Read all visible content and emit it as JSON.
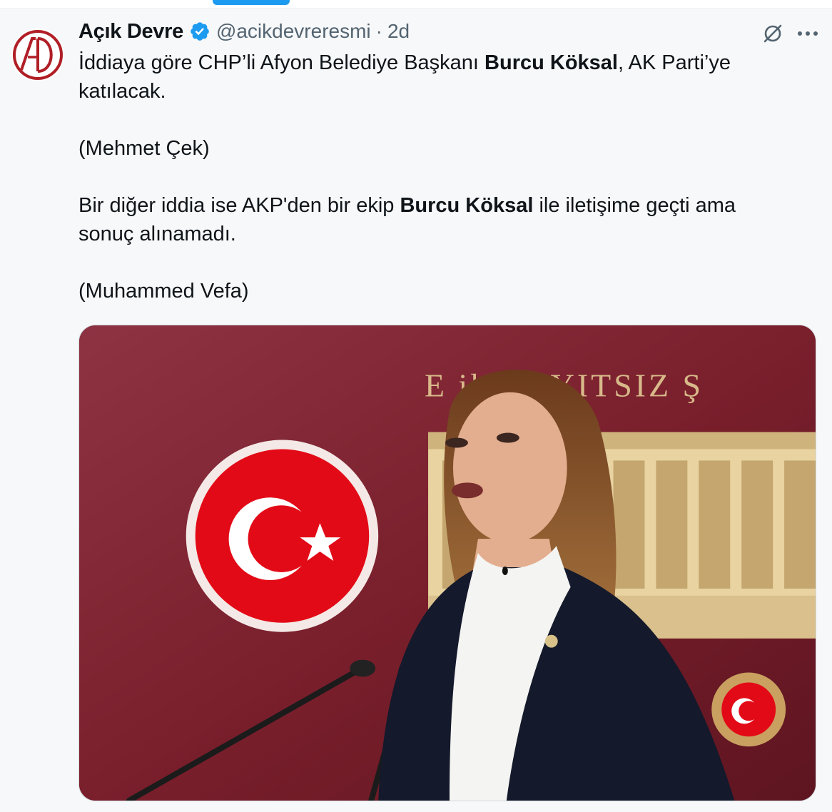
{
  "tweet": {
    "author": {
      "display_name": "Açık Devre",
      "handle": "@acikdevreresmi",
      "verified": true,
      "avatar_logo_text": "AD"
    },
    "separator": "·",
    "time": "2d",
    "paragraphs": [
      {
        "pre": "İddiaya göre CHP’li Afyon Belediye Başkanı ",
        "bold": "Burcu Köksal",
        "post": ", AK Parti’ye katılacak."
      },
      {
        "text": "(Mehmet Çek)"
      },
      {
        "pre": "Bir diğer iddia ise AKP'den bir ekip ",
        "bold": "Burcu Köksal",
        "post": " ile iletişime geçti ama sonuç alınamadı."
      },
      {
        "text": "(Muhammed Vefa)"
      }
    ],
    "media": {
      "backdrop_text": "E          ik KAYITSIZ Ş"
    }
  },
  "icons": [
    "verified-badge-icon",
    "grok-icon",
    "more-icon",
    "turkish-flag-icon",
    "tbmm-emblem-icon"
  ],
  "colors": {
    "accent": "#1d9bf0",
    "text": "#0f1419",
    "muted": "#536471",
    "backdrop": "#7a1f2a",
    "flag_red": "#e30a17",
    "logo_red": "#b01e26"
  }
}
